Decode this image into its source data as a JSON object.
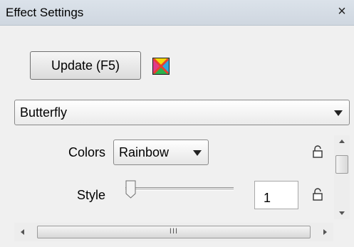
{
  "window": {
    "title": "Effect Settings",
    "close_label": "×"
  },
  "toolbar": {
    "update_label": "Update (F5)",
    "effect_icon": "rainbow-x-icon"
  },
  "effect": {
    "selected": "Butterfly"
  },
  "settings": {
    "colors": {
      "label": "Colors",
      "selected": "Rainbow"
    },
    "style": {
      "label": "Style",
      "value": "1",
      "slider_fraction": 0.0
    }
  },
  "scrollbars": {
    "horizontal_grip": "III"
  },
  "colors": {
    "accent": "#cfd7e0",
    "panel_bg": "#f0f0f0"
  }
}
